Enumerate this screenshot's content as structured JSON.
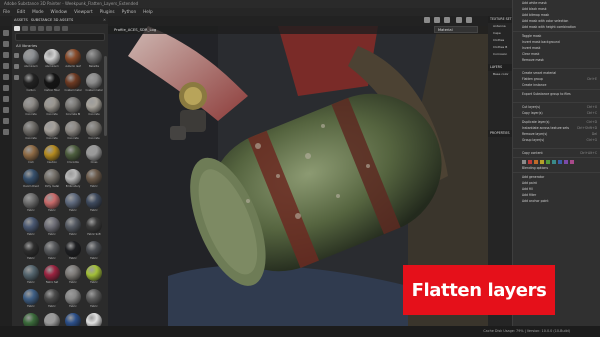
{
  "window": {
    "title": "Adobe Substance 3D Painter - Weekpunk_Flatten_Layers_Extended"
  },
  "menu": [
    "File",
    "Edit",
    "Mode",
    "Window",
    "Viewport",
    "Plugins",
    "Python",
    "Help"
  ],
  "assets_panel": {
    "tabs": [
      "ASSETS",
      "SUBSTANCE 3D ASSETS"
    ],
    "library_label": "All libraries",
    "materials": [
      {
        "name": "Aluminium",
        "color": "#8c8f92"
      },
      {
        "name": "Aluminium",
        "color": "#cfcfcf"
      },
      {
        "name": "Autumn leaf",
        "color": "#8a4b2a"
      },
      {
        "name": "Bakelite",
        "color": "#6b6b6b"
      },
      {
        "name": "Carbon",
        "color": "#222"
      },
      {
        "name": "Carbon fiber",
        "color": "#141414"
      },
      {
        "name": "Coated metal",
        "color": "#6e3a22"
      },
      {
        "name": "Coated metal",
        "color": "#8a8a8a"
      },
      {
        "name": "Concrete",
        "color": "#8d8a86"
      },
      {
        "name": "Concrete",
        "color": "#9a968f"
      },
      {
        "name": "Concrete Bl",
        "color": "#7c7a77"
      },
      {
        "name": "Concrete",
        "color": "#a7a39b"
      },
      {
        "name": "Concrete",
        "color": "#6f6c68"
      },
      {
        "name": "Concrete",
        "color": "#a5a09a"
      },
      {
        "name": "Concrete",
        "color": "#8e8a85"
      },
      {
        "name": "Concrete",
        "color": "#7d7a75"
      },
      {
        "name": "Cork",
        "color": "#8f6b45"
      },
      {
        "name": "Caution",
        "color": "#b48a1f"
      },
      {
        "name": "Crocodile",
        "color": "#4d5e3e"
      },
      {
        "name": "Cross",
        "color": "#9a9a9a"
      },
      {
        "name": "Denim Rivet",
        "color": "#37506c"
      },
      {
        "name": "Dirty metal",
        "color": "#757069"
      },
      {
        "name": "Embroidery",
        "color": "#b8b8b8"
      },
      {
        "name": "Fabric",
        "color": "#6b5a4a"
      },
      {
        "name": "Fabric",
        "color": "#6e6e6e"
      },
      {
        "name": "Fabric",
        "color": "#c86a6a"
      },
      {
        "name": "Fabric",
        "color": "#5f6a7e"
      },
      {
        "name": "Fabric",
        "color": "#3e4a5e"
      },
      {
        "name": "Fabric",
        "color": "#4a5872"
      },
      {
        "name": "Fabric",
        "color": "#6f6f78"
      },
      {
        "name": "Fabric",
        "color": "#555a63"
      },
      {
        "name": "Fabric Soft",
        "color": "#3a3a3a"
      },
      {
        "name": "Fabric",
        "color": "#2e2e2e"
      },
      {
        "name": "Fabric",
        "color": "#57595c"
      },
      {
        "name": "Fabric",
        "color": "#1e1f22"
      },
      {
        "name": "Fabric",
        "color": "#4a4d52"
      },
      {
        "name": "Fabric",
        "color": "#55666f"
      },
      {
        "name": "Fabric Sat",
        "color": "#9b2340"
      },
      {
        "name": "Fabric",
        "color": "#7e7b78"
      },
      {
        "name": "Fabric",
        "color": "#a3c038"
      },
      {
        "name": "Fabric",
        "color": "#3f5f85"
      },
      {
        "name": "Fabric",
        "color": "#4a4a4a"
      },
      {
        "name": "Fabric",
        "color": "#878787"
      },
      {
        "name": "Fabric",
        "color": "#5c5c5c"
      },
      {
        "name": "",
        "color": "#3b6b3b"
      },
      {
        "name": "",
        "color": "#9a9a9a"
      },
      {
        "name": "",
        "color": "#2b4f8a"
      },
      {
        "name": "",
        "color": "#e0e0e0"
      }
    ]
  },
  "viewport": {
    "tab": "Profile_ACES_SDR_Log",
    "mode": "Material"
  },
  "right_panel": {
    "texture_set": "TEXTURE SET LIST",
    "items": [
      "Antenna",
      "Cape",
      "Clothes",
      "Clothes B",
      "Corrosion"
    ],
    "layers": "LAYERS",
    "base": "Base color",
    "properties": "PROPERTIES"
  },
  "context_menu": {
    "groups": [
      [
        {
          "label": "Add white mask",
          "sc": ""
        },
        {
          "label": "Add black mask",
          "sc": ""
        },
        {
          "label": "Add bitmap mask",
          "sc": ""
        },
        {
          "label": "Add mask with color selection",
          "sc": ""
        },
        {
          "label": "Add mask with height combination",
          "sc": ""
        }
      ],
      [
        {
          "label": "Toggle mask",
          "sc": ""
        },
        {
          "label": "Invert mask background",
          "sc": ""
        },
        {
          "label": "Invert mask",
          "sc": ""
        },
        {
          "label": "Clear mask",
          "sc": ""
        },
        {
          "label": "Remove mask",
          "sc": ""
        }
      ],
      [
        {
          "label": "Create smart material",
          "sc": ""
        },
        {
          "label": "Flatten group",
          "sc": "Ctrl+E"
        },
        {
          "label": "Create instance",
          "sc": ""
        }
      ],
      [
        {
          "label": "Export Substance group to files",
          "sc": ""
        }
      ],
      [
        {
          "label": "Cut layer(s)",
          "sc": "Ctrl+X"
        },
        {
          "label": "Copy layer(s)",
          "sc": "Ctrl+C"
        }
      ],
      [
        {
          "label": "Duplicate layer(s)",
          "sc": "Ctrl+D"
        },
        {
          "label": "Instantiate across texture sets",
          "sc": "Ctrl+Shift+D"
        },
        {
          "label": "Remove layer(s)",
          "sc": "Del"
        },
        {
          "label": "Group layer(s)",
          "sc": "Ctrl+G"
        }
      ],
      [
        {
          "label": "Copy content",
          "sc": "Ctrl+Alt+C"
        }
      ],
      [
        {
          "label": "Blending options",
          "sc": ""
        }
      ],
      [
        {
          "label": "Add generator",
          "sc": ""
        },
        {
          "label": "Add paint",
          "sc": ""
        },
        {
          "label": "Add fill",
          "sc": ""
        },
        {
          "label": "Add filter",
          "sc": ""
        },
        {
          "label": "Add anchor point",
          "sc": ""
        }
      ]
    ],
    "swatches": [
      "#8a8a8a",
      "#c03a3a",
      "#c06a2a",
      "#b5a02a",
      "#4f9a3a",
      "#3a8a8a",
      "#3a5fa8",
      "#7a4aa8",
      "#a84a8a"
    ]
  },
  "status": {
    "text": "Cache Disk Usage:  79% | Version: 10.0.0 (10-Build)"
  },
  "caption": {
    "text": "Flatten layers"
  }
}
